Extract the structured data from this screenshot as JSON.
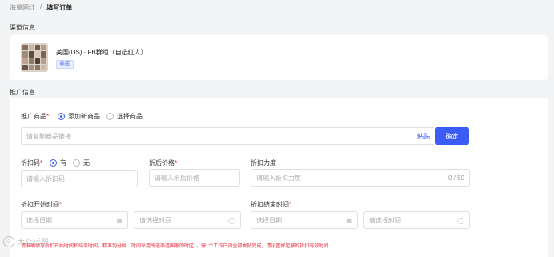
{
  "breadcrumb": {
    "parent": "海量网红",
    "sep": "/",
    "current": "填写订单"
  },
  "channel": {
    "section_title": "渠道信息",
    "name": "美国(US) · FB群组（自选红人）",
    "tag": "美国"
  },
  "promo": {
    "section_title": "推广信息",
    "product": {
      "label": "推广商品",
      "required_mark": "*",
      "opt_new": "添加新商品",
      "opt_select": "选择商品",
      "link_placeholder": "请复制商品链接",
      "paste_label": "粘贴",
      "confirm_label": "确定"
    },
    "coupon": {
      "label": "折扣码",
      "required_mark": "*",
      "opt_yes": "有",
      "opt_no": "无",
      "placeholder": "请输入折扣码"
    },
    "after_price": {
      "label": "折后价格",
      "required_mark": "*",
      "placeholder": "请输入折后价格"
    },
    "discount": {
      "label": "折扣力度",
      "placeholder": "请输入折扣力度",
      "counter": "0 / 50"
    },
    "start": {
      "label": "折扣开始时间",
      "required_mark": "*",
      "date_placeholder": "选择日期",
      "time_placeholder": "请选择时间"
    },
    "end": {
      "label": "折扣结束时间",
      "required_mark": "*",
      "date_placeholder": "选择日期",
      "time_placeholder": "请选择时间"
    },
    "note": "请准确填写折扣开始时间和结束时间，精准到分钟（时间采用所选渠道国家的时区），需1个工作日内全部发帖完成，请设置好足够的折扣有效时间"
  },
  "watermark": {
    "text": "大众话题"
  },
  "colors": {
    "accent": "#3b5bf5",
    "required": "#e23333",
    "tag_bg": "#eaf0ff"
  }
}
